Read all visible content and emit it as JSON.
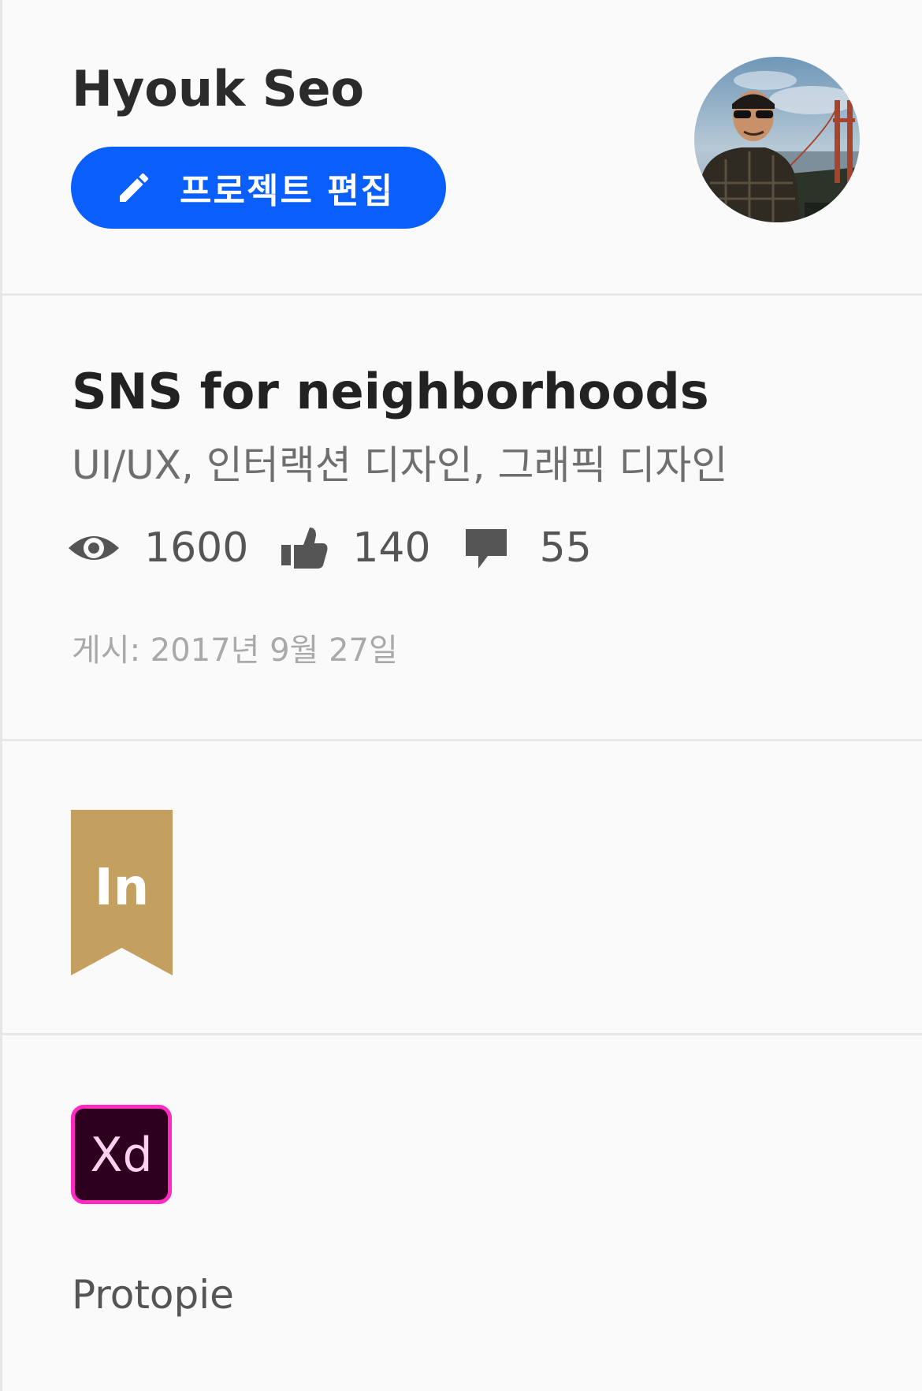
{
  "header": {
    "owner_name": "Hyouk Seo",
    "edit_button_label": "프로젝트 편집",
    "edit_icon": "pencil-icon",
    "avatar_icon": "profile-photo"
  },
  "project": {
    "title": "SNS for neighborhoods",
    "fields": "UI/UX, 인터랙션 디자인, 그래픽 디자인",
    "stats": {
      "views": "1600",
      "likes": "140",
      "comments": "55"
    },
    "published": "게시: 2017년 9월 27일"
  },
  "badge": {
    "icon": "ribbon-badge-icon",
    "text": "In"
  },
  "tools": {
    "icon": "adobe-xd-icon",
    "icon_text": "Xd",
    "name": "Protopie"
  },
  "colors": {
    "accent": "#0a5efc",
    "ribbon": "#c39f60",
    "xd_border": "#ff2bc2",
    "xd_bg": "#2e001e"
  }
}
